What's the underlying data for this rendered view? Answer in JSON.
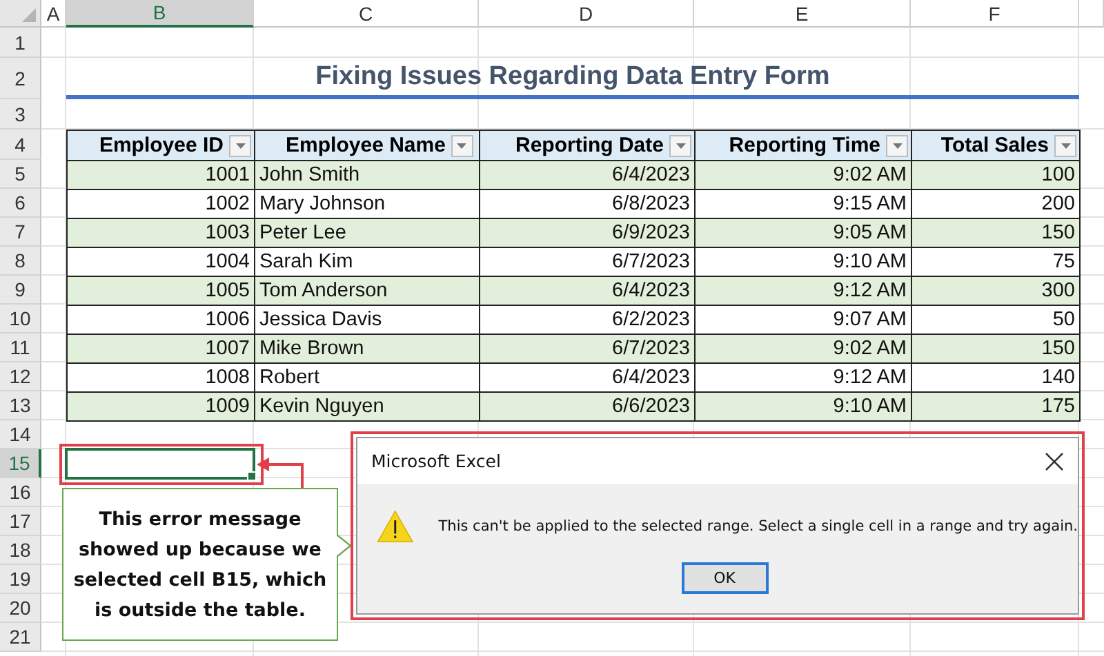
{
  "sheet": {
    "column_headers": [
      {
        "label": "A",
        "selected": false
      },
      {
        "label": "B",
        "selected": true
      },
      {
        "label": "C",
        "selected": false
      },
      {
        "label": "D",
        "selected": false
      },
      {
        "label": "E",
        "selected": false
      },
      {
        "label": "F",
        "selected": false
      }
    ],
    "row_headers": [
      {
        "label": "1",
        "selected": false
      },
      {
        "label": "2",
        "selected": false
      },
      {
        "label": "3",
        "selected": false
      },
      {
        "label": "4",
        "selected": false
      },
      {
        "label": "5",
        "selected": false
      },
      {
        "label": "6",
        "selected": false
      },
      {
        "label": "7",
        "selected": false
      },
      {
        "label": "8",
        "selected": false
      },
      {
        "label": "9",
        "selected": false
      },
      {
        "label": "10",
        "selected": false
      },
      {
        "label": "11",
        "selected": false
      },
      {
        "label": "12",
        "selected": false
      },
      {
        "label": "13",
        "selected": false
      },
      {
        "label": "14",
        "selected": false
      },
      {
        "label": "15",
        "selected": true
      },
      {
        "label": "16",
        "selected": false
      },
      {
        "label": "17",
        "selected": false
      },
      {
        "label": "18",
        "selected": false
      },
      {
        "label": "19",
        "selected": false
      },
      {
        "label": "20",
        "selected": false
      },
      {
        "label": "21",
        "selected": false
      }
    ],
    "title": "Fixing Issues Regarding Data Entry Form",
    "table": {
      "columns": [
        {
          "label": "Employee ID",
          "kind": "number"
        },
        {
          "label": "Employee Name",
          "kind": "text"
        },
        {
          "label": "Reporting Date",
          "kind": "number"
        },
        {
          "label": "Reporting Time",
          "kind": "number"
        },
        {
          "label": "Total Sales",
          "kind": "number"
        }
      ],
      "rows": [
        [
          "1001",
          "John Smith",
          "6/4/2023",
          "9:02 AM",
          "100"
        ],
        [
          "1002",
          "Mary Johnson",
          "6/8/2023",
          "9:15 AM",
          "200"
        ],
        [
          "1003",
          "Peter Lee",
          "6/9/2023",
          "9:05 AM",
          "150"
        ],
        [
          "1004",
          "Sarah Kim",
          "6/7/2023",
          "9:10 AM",
          "75"
        ],
        [
          "1005",
          "Tom Anderson",
          "6/4/2023",
          "9:12 AM",
          "300"
        ],
        [
          "1006",
          "Jessica Davis",
          "6/2/2023",
          "9:07 AM",
          "50"
        ],
        [
          "1007",
          "Mike Brown",
          "6/7/2023",
          "9:02 AM",
          "150"
        ],
        [
          "1008",
          "Robert",
          "6/4/2023",
          "9:12 AM",
          "140"
        ],
        [
          "1009",
          "Kevin Nguyen",
          "6/6/2023",
          "9:10 AM",
          "175"
        ]
      ]
    }
  },
  "callout": {
    "text": "This error message showed up because we selected cell B15, which is outside the table."
  },
  "dialog": {
    "title": "Microsoft Excel",
    "message": "This can't be applied to the selected range. Select a single cell in a range and try again.",
    "buttons": [
      "OK"
    ]
  }
}
